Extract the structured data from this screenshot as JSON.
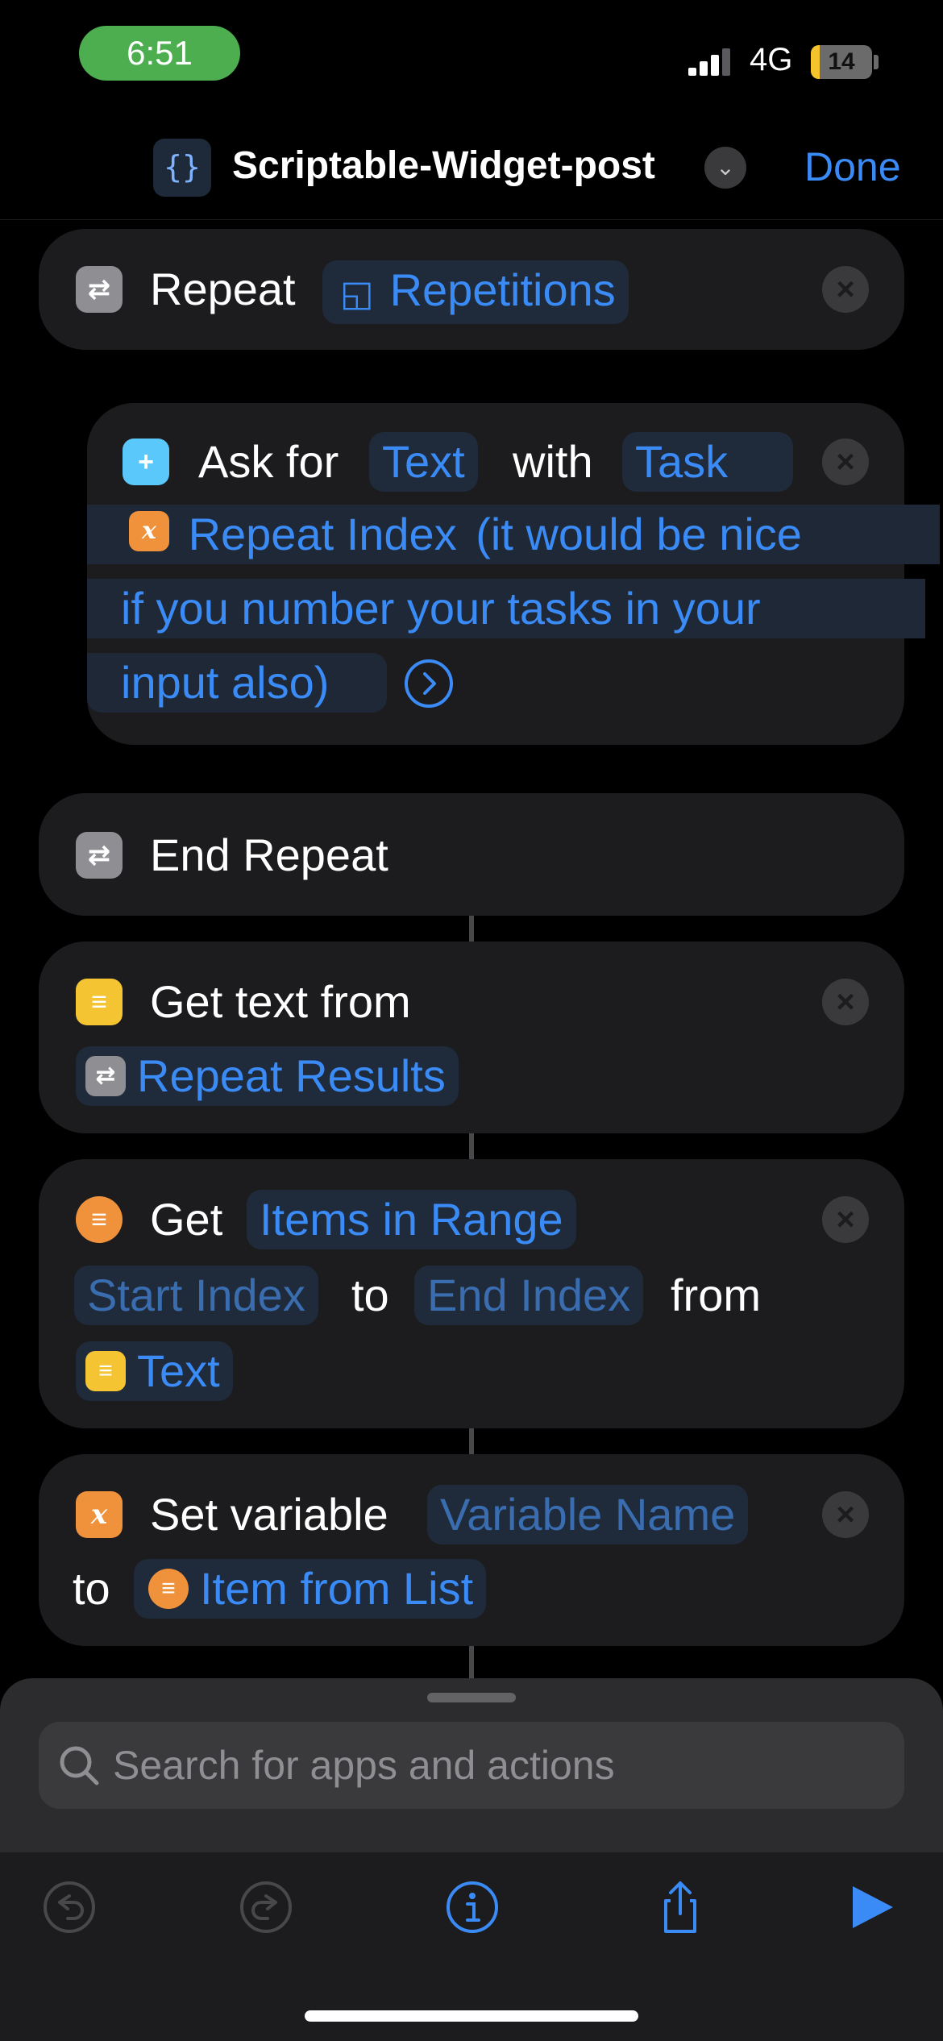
{
  "status": {
    "time": "6:51",
    "network": "4G",
    "battery": "14",
    "battery_level": 0.14
  },
  "nav": {
    "icon_glyph": "{}",
    "title": "Scriptable-Widget-post",
    "done": "Done"
  },
  "actions": {
    "repeat": {
      "label": "Repeat",
      "param": "Repetitions"
    },
    "ask": {
      "label": "Ask for",
      "type": "Text",
      "with": "with",
      "prompt_start": "Task",
      "var": "Repeat Index",
      "line1_rest": "(it would be nice",
      "line2": "if you number your tasks in your",
      "line3": "input also)"
    },
    "end_repeat": {
      "label": "End Repeat"
    },
    "get_text": {
      "label": "Get text from",
      "source": "Repeat Results"
    },
    "get_items": {
      "label": "Get",
      "mode": "Items in Range",
      "start_ph": "Start Index",
      "to": "to",
      "end_ph": "End Index",
      "from": "from",
      "source": "Text"
    },
    "set_var": {
      "label": "Set variable",
      "name_ph": "Variable Name",
      "to": "to",
      "value": "Item from List"
    }
  },
  "search": {
    "placeholder": "Search for apps and actions"
  },
  "toolbar": {
    "undo": "undo-icon",
    "redo": "redo-icon",
    "info": "info-icon",
    "share": "share-icon",
    "play": "play-icon"
  },
  "colors": {
    "accent": "#3b8bf6",
    "card": "#1c1c1e",
    "battery": "#f5c42c",
    "time_pill": "#4cae4f"
  }
}
